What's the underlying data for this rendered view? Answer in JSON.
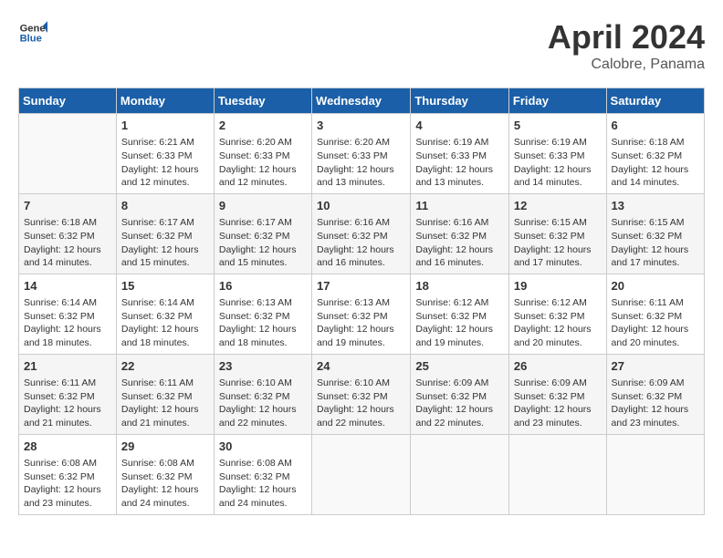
{
  "header": {
    "logo_line1": "General",
    "logo_line2": "Blue",
    "title": "April 2024",
    "subtitle": "Calobre, Panama"
  },
  "columns": [
    "Sunday",
    "Monday",
    "Tuesday",
    "Wednesday",
    "Thursday",
    "Friday",
    "Saturday"
  ],
  "weeks": [
    [
      {
        "num": "",
        "empty": true
      },
      {
        "num": "1",
        "sunrise": "6:21 AM",
        "sunset": "6:33 PM",
        "daylight": "12 hours and 12 minutes."
      },
      {
        "num": "2",
        "sunrise": "6:20 AM",
        "sunset": "6:33 PM",
        "daylight": "12 hours and 12 minutes."
      },
      {
        "num": "3",
        "sunrise": "6:20 AM",
        "sunset": "6:33 PM",
        "daylight": "12 hours and 13 minutes."
      },
      {
        "num": "4",
        "sunrise": "6:19 AM",
        "sunset": "6:33 PM",
        "daylight": "12 hours and 13 minutes."
      },
      {
        "num": "5",
        "sunrise": "6:19 AM",
        "sunset": "6:33 PM",
        "daylight": "12 hours and 14 minutes."
      },
      {
        "num": "6",
        "sunrise": "6:18 AM",
        "sunset": "6:32 PM",
        "daylight": "12 hours and 14 minutes."
      }
    ],
    [
      {
        "num": "7",
        "sunrise": "6:18 AM",
        "sunset": "6:32 PM",
        "daylight": "12 hours and 14 minutes."
      },
      {
        "num": "8",
        "sunrise": "6:17 AM",
        "sunset": "6:32 PM",
        "daylight": "12 hours and 15 minutes."
      },
      {
        "num": "9",
        "sunrise": "6:17 AM",
        "sunset": "6:32 PM",
        "daylight": "12 hours and 15 minutes."
      },
      {
        "num": "10",
        "sunrise": "6:16 AM",
        "sunset": "6:32 PM",
        "daylight": "12 hours and 16 minutes."
      },
      {
        "num": "11",
        "sunrise": "6:16 AM",
        "sunset": "6:32 PM",
        "daylight": "12 hours and 16 minutes."
      },
      {
        "num": "12",
        "sunrise": "6:15 AM",
        "sunset": "6:32 PM",
        "daylight": "12 hours and 17 minutes."
      },
      {
        "num": "13",
        "sunrise": "6:15 AM",
        "sunset": "6:32 PM",
        "daylight": "12 hours and 17 minutes."
      }
    ],
    [
      {
        "num": "14",
        "sunrise": "6:14 AM",
        "sunset": "6:32 PM",
        "daylight": "12 hours and 18 minutes."
      },
      {
        "num": "15",
        "sunrise": "6:14 AM",
        "sunset": "6:32 PM",
        "daylight": "12 hours and 18 minutes."
      },
      {
        "num": "16",
        "sunrise": "6:13 AM",
        "sunset": "6:32 PM",
        "daylight": "12 hours and 18 minutes."
      },
      {
        "num": "17",
        "sunrise": "6:13 AM",
        "sunset": "6:32 PM",
        "daylight": "12 hours and 19 minutes."
      },
      {
        "num": "18",
        "sunrise": "6:12 AM",
        "sunset": "6:32 PM",
        "daylight": "12 hours and 19 minutes."
      },
      {
        "num": "19",
        "sunrise": "6:12 AM",
        "sunset": "6:32 PM",
        "daylight": "12 hours and 20 minutes."
      },
      {
        "num": "20",
        "sunrise": "6:11 AM",
        "sunset": "6:32 PM",
        "daylight": "12 hours and 20 minutes."
      }
    ],
    [
      {
        "num": "21",
        "sunrise": "6:11 AM",
        "sunset": "6:32 PM",
        "daylight": "12 hours and 21 minutes."
      },
      {
        "num": "22",
        "sunrise": "6:11 AM",
        "sunset": "6:32 PM",
        "daylight": "12 hours and 21 minutes."
      },
      {
        "num": "23",
        "sunrise": "6:10 AM",
        "sunset": "6:32 PM",
        "daylight": "12 hours and 22 minutes."
      },
      {
        "num": "24",
        "sunrise": "6:10 AM",
        "sunset": "6:32 PM",
        "daylight": "12 hours and 22 minutes."
      },
      {
        "num": "25",
        "sunrise": "6:09 AM",
        "sunset": "6:32 PM",
        "daylight": "12 hours and 22 minutes."
      },
      {
        "num": "26",
        "sunrise": "6:09 AM",
        "sunset": "6:32 PM",
        "daylight": "12 hours and 23 minutes."
      },
      {
        "num": "27",
        "sunrise": "6:09 AM",
        "sunset": "6:32 PM",
        "daylight": "12 hours and 23 minutes."
      }
    ],
    [
      {
        "num": "28",
        "sunrise": "6:08 AM",
        "sunset": "6:32 PM",
        "daylight": "12 hours and 23 minutes."
      },
      {
        "num": "29",
        "sunrise": "6:08 AM",
        "sunset": "6:32 PM",
        "daylight": "12 hours and 24 minutes."
      },
      {
        "num": "30",
        "sunrise": "6:08 AM",
        "sunset": "6:32 PM",
        "daylight": "12 hours and 24 minutes."
      },
      {
        "num": "",
        "empty": true
      },
      {
        "num": "",
        "empty": true
      },
      {
        "num": "",
        "empty": true
      },
      {
        "num": "",
        "empty": true
      }
    ]
  ],
  "labels": {
    "sunrise": "Sunrise:",
    "sunset": "Sunset:",
    "daylight": "Daylight:"
  }
}
